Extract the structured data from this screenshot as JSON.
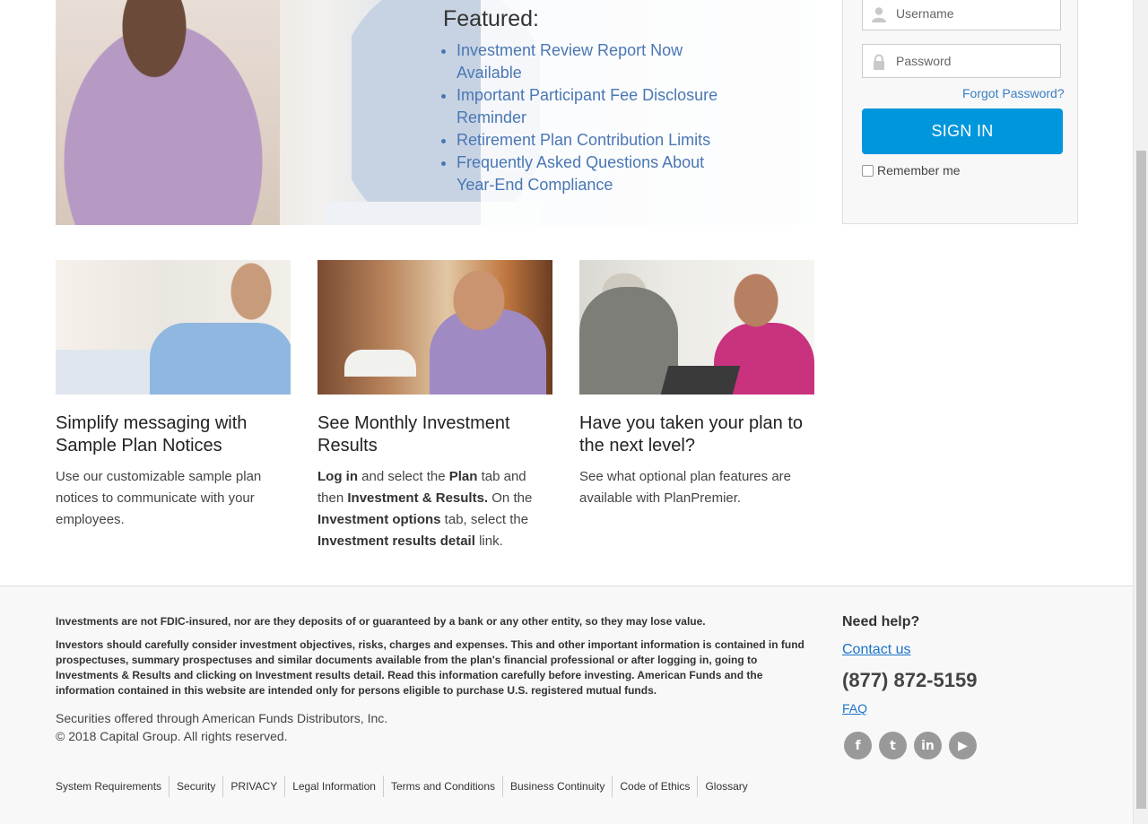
{
  "featured": {
    "title": "Featured:",
    "items": [
      "Investment Review Report Now Available",
      "Important Participant Fee Disclosure Reminder",
      "Retirement Plan Contribution Limits",
      "Frequently Asked Questions About Year-End Compliance"
    ]
  },
  "login": {
    "username_placeholder": "Username",
    "password_placeholder": "Password",
    "forgot_label": "Forgot Password?",
    "signin_label": "SIGN IN",
    "remember_label": "Remember me"
  },
  "cards": [
    {
      "title": "Simplify messaging with Sample Plan Notices",
      "body": "Use our customizable sample plan notices to communicate with your employees."
    },
    {
      "title": "See Monthly Investment Results",
      "body_parts": [
        "Log in",
        " and select the ",
        "Plan",
        " tab and then ",
        "Investment & Results.",
        " On the ",
        "Investment options",
        " tab, select the ",
        "Investment results detail",
        " link."
      ]
    },
    {
      "title": "Have you taken your plan to the next level?",
      "body": "See what optional plan features are available with PlanPremier."
    }
  ],
  "footer": {
    "disclaimer1": "Investments are not FDIC-insured, nor are they deposits of or guaranteed by a bank or any other entity, so they may lose value.",
    "disclaimer2": "Investors should carefully consider investment objectives, risks, charges and expenses. This and other important information is contained in fund prospectuses, summary prospectuses and similar documents available from the plan's financial professional or after logging in, going to Investments & Results and clicking on Investment results detail. Read this information carefully before investing. American Funds and the information contained in this website are intended only for persons eligible to purchase U.S. registered mutual funds.",
    "securities": "Securities offered through American Funds Distributors, Inc.",
    "copyright": "© 2018 Capital Group. All rights reserved.",
    "links": [
      "System Requirements",
      "Security",
      "PRIVACY",
      "Legal Information",
      "Terms and Conditions",
      "Business Continuity",
      "Code of Ethics",
      "Glossary"
    ],
    "help": {
      "title": "Need help?",
      "contact": "Contact us",
      "phone": "(877) 872-5159",
      "faq": "FAQ"
    },
    "social": [
      {
        "icon": "facebook-icon",
        "glyph": "f"
      },
      {
        "icon": "twitter-icon",
        "glyph": "t"
      },
      {
        "icon": "linkedin-icon",
        "glyph": "in"
      },
      {
        "icon": "youtube-icon",
        "glyph": "▶"
      }
    ]
  },
  "colors": {
    "accent": "#0096dc",
    "link": "#4a77b4"
  }
}
